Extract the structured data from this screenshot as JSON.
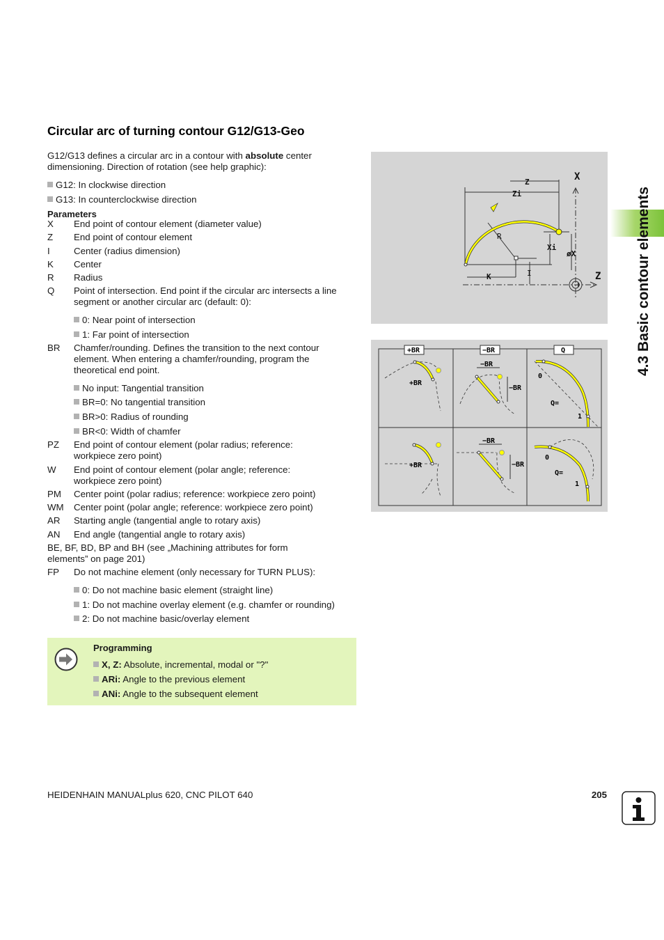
{
  "title": "Circular arc of turning contour G12/G13-Geo",
  "intro": {
    "before": "G12/G13 defines a circular arc in a contour with ",
    "bold": "absolute",
    "after": " center dimensioning. Direction of rotation (see help graphic):"
  },
  "directions": [
    "G12: In clockwise direction",
    "G13: In counterclockwise direction"
  ],
  "parameters_heading": "Parameters",
  "parameters": [
    {
      "key": "X",
      "desc": "End point of contour element (diameter value)"
    },
    {
      "key": "Z",
      "desc": "End point of contour element"
    },
    {
      "key": "I",
      "desc": "Center (radius dimension)"
    },
    {
      "key": "K",
      "desc": "Center"
    },
    {
      "key": "R",
      "desc": "Radius"
    },
    {
      "key": "Q",
      "desc": "Point of intersection. End point if the circular arc intersects a line segment or another circular arc (default: 0):"
    },
    {
      "key": "BR",
      "desc": "Chamfer/rounding. Defines the transition to the next contour element. When entering a chamfer/rounding, program the theoretical end point."
    },
    {
      "key": "PZ",
      "desc": "End point of contour element (polar radius; reference: workpiece zero point)"
    },
    {
      "key": "W",
      "desc": "End point of contour element (polar angle; reference: workpiece zero point)"
    },
    {
      "key": "PM",
      "desc": "Center point (polar radius; reference: workpiece zero point)"
    },
    {
      "key": "WM",
      "desc": "Center point (polar angle; reference: workpiece zero point)"
    },
    {
      "key": "AR",
      "desc": "Starting angle (tangential angle to rotary axis)"
    },
    {
      "key": "AN",
      "desc": "End angle (tangential angle to rotary axis)"
    },
    {
      "key": "FP",
      "desc": "Do not machine element (only necessary for TURN PLUS):"
    }
  ],
  "q_options": [
    "0: Near point of intersection",
    "1: Far point of intersection"
  ],
  "br_options": [
    "No input: Tangential transition",
    "BR=0: No tangential transition",
    "BR>0: Radius of rounding",
    "BR<0: Width of chamfer"
  ],
  "machining_attrs": "BE, BF, BD, BP and BH (see „Machining attributes for form elements” on page 201)",
  "fp_options": [
    "0: Do not machine basic element (straight line)",
    "1: Do not machine overlay element (e.g. chamfer or rounding)",
    "2: Do not machine basic/overlay element"
  ],
  "programming": {
    "title": "Programming",
    "items": [
      {
        "bold": "X, Z:",
        "text": " Absolute, incremental, modal or \"?\""
      },
      {
        "bold": "ARi:",
        "text": " Angle to the previous element"
      },
      {
        "bold": "ANi:",
        "text": " Angle to the subsequent element"
      }
    ]
  },
  "figure1": {
    "labels": {
      "z": "Z",
      "zi": "Zi",
      "r": "R",
      "xi": "Xi",
      "dx": "øX",
      "k": "K",
      "i": "I",
      "axis_x": "X",
      "axis_z": "Z"
    }
  },
  "figure2": {
    "headers": [
      "+BR",
      "−BR",
      "Q"
    ],
    "labels": {
      "plus_br": "+BR",
      "minus_br": "−BR",
      "q_eq": "Q=",
      "zero": "0",
      "one": "1"
    }
  },
  "colors": {
    "accent_green": "#7cc33a",
    "note_bg": "#e3f5bc",
    "arc_yellow": "#ffff00",
    "figure_bg": "#d5d5d5"
  },
  "side_tab": "4.3 Basic contour elements",
  "footer": {
    "text": "HEIDENHAIN MANUALplus 620, CNC PILOT 640",
    "page": "205"
  }
}
